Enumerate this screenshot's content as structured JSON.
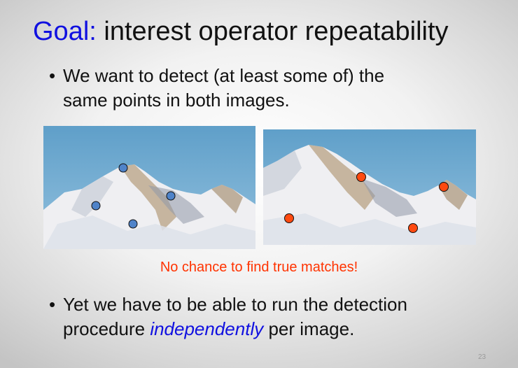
{
  "title": {
    "keyword": "Goal:",
    "rest": "interest operator repeatability"
  },
  "bullets": [
    {
      "marker": "•",
      "line1": "We want to detect (at least some of) the",
      "line2": "same points in both images."
    },
    {
      "marker": "•",
      "line1": "Yet we have to be able to run the detection",
      "line2_before": "procedure ",
      "line2_emph": "independently",
      "line2_after": " per image."
    }
  ],
  "caption": "No chance to find true matches!",
  "slide_number": "23",
  "colors": {
    "keyword": "#1010e0",
    "caption": "#ff3300",
    "left_points": "#4f83c9",
    "right_points": "#ff4a10"
  }
}
